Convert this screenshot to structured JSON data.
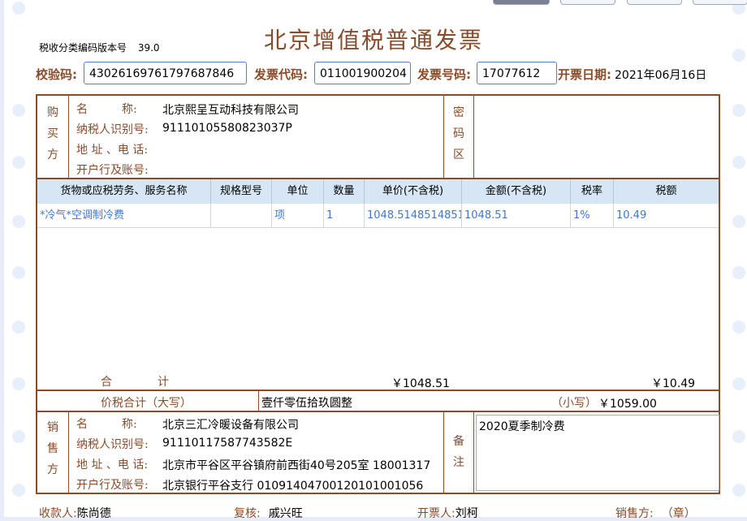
{
  "invoice": {
    "title": "北京增值税普通发票",
    "version_label": "税收分类编码版本号",
    "version": "39.0",
    "check_code_label": "校验码:",
    "check_code": "43026169761797687846",
    "invoice_code_label": "发票代码:",
    "invoice_code": "011001900204",
    "invoice_no_label": "发票号码:",
    "invoice_no": "17077612",
    "date_label": "开票日期:",
    "date": "2021年06月16日"
  },
  "buyer": {
    "section_label": [
      "购",
      "买",
      "方"
    ],
    "name_label": "名　　　称:",
    "name": "北京熙呈互动科技有限公司",
    "tax_id_label": "纳税人识别号:",
    "tax_id": "91110105580823037P",
    "address_label": "地 址 、电 话:",
    "address": "",
    "bank_label": "开户行及账号:",
    "bank": ""
  },
  "cipher": {
    "section_label": [
      "密",
      "码",
      "区"
    ]
  },
  "items": {
    "headers": [
      "货物或应税劳务、服务名称",
      "规格型号",
      "单位",
      "数量",
      "单价(不含税)",
      "金额(不含税)",
      "税率",
      "税额"
    ],
    "rows": [
      [
        "*冷气*空调制冷费",
        "",
        "项",
        "1",
        "1048.5148514851",
        "1048.51",
        "1%",
        "10.49"
      ]
    ]
  },
  "totals": {
    "label": "合　　　　计",
    "amount": "￥1048.51",
    "tax": "￥10.49",
    "grand_label": "价税合计（大写）",
    "grand_words": "壹仟零伍拾玖圆整",
    "small_label": "（小写）",
    "grand_amount": "￥1059.00"
  },
  "seller": {
    "section_label": [
      "销",
      "售",
      "方"
    ],
    "name_label": "名　　　称:",
    "name": "北京三汇冷暖设备有限公司",
    "tax_id_label": "纳税人识别号:",
    "tax_id": "91110117587743582E",
    "address_label": "地 址 、电 话:",
    "address": "北京市平谷区平谷镇府前西街40号205室 18001317",
    "bank_label": "开户行及账号:",
    "bank": "北京银行平谷支行 01091404700120101001056"
  },
  "remark": {
    "section_label": [
      "备",
      "注"
    ],
    "text": "2020夏季制冷费"
  },
  "footer": {
    "payee_label": "收款人:",
    "payee": "陈尚德",
    "reviewer_label": "复核:",
    "reviewer": "戚兴旺",
    "issuer_label": "开票人:",
    "issuer": "刘柯",
    "seller_label": "销售方:",
    "seal": "（章）"
  }
}
